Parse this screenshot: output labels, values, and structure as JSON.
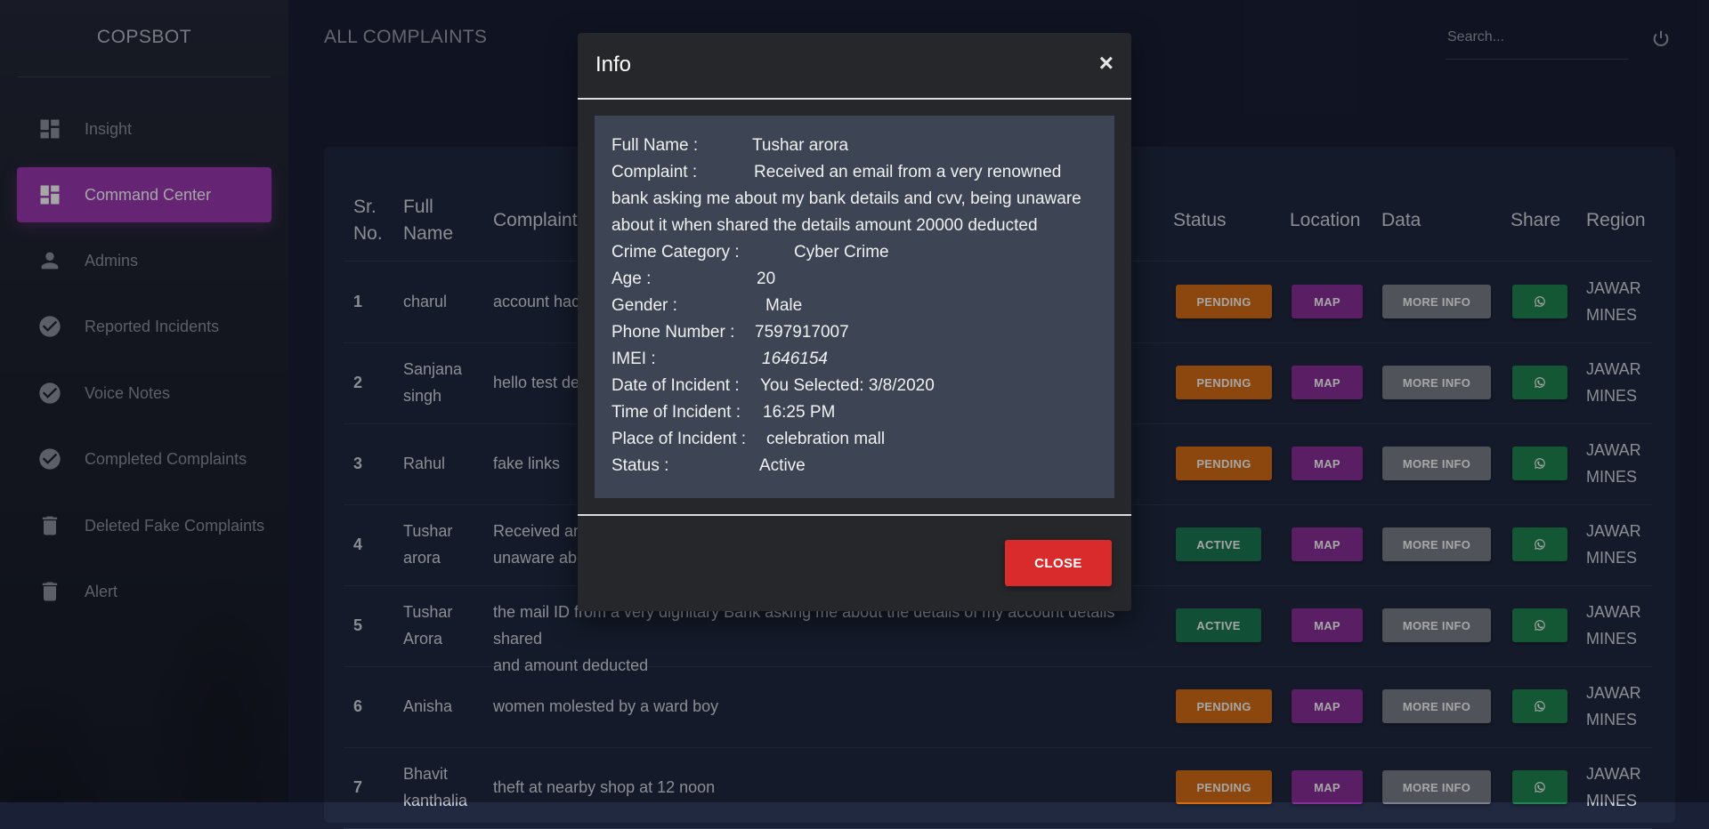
{
  "brand": "COPSBOT",
  "sidebar": {
    "items": [
      {
        "label": "Insight",
        "icon": "dashboard-icon",
        "active": false
      },
      {
        "label": "Command Center",
        "icon": "dashboard-icon",
        "active": true
      },
      {
        "label": "Admins",
        "icon": "person-icon",
        "active": false
      },
      {
        "label": "Reported Incidents",
        "icon": "check-circle-icon",
        "active": false
      },
      {
        "label": "Voice Notes",
        "icon": "check-circle-icon",
        "active": false
      },
      {
        "label": "Completed Complaints",
        "icon": "check-circle-icon",
        "active": false
      },
      {
        "label": "Deleted Fake Complaints",
        "icon": "trash-icon",
        "active": false
      },
      {
        "label": "Alert",
        "icon": "trash-icon",
        "active": false
      }
    ]
  },
  "header": {
    "title": "ALL COMPLAINTS",
    "search_placeholder": "Search..."
  },
  "table": {
    "columns": {
      "sr_line1": "Sr.",
      "sr_line2": "No.",
      "name_line1": "Full",
      "name_line2": "Name",
      "complaint": "Complaint",
      "status": "Status",
      "location": "Location",
      "data": "Data",
      "share": "Share",
      "region": "Region"
    },
    "buttons": {
      "map": "MAP",
      "more_info": "MORE INFO"
    },
    "rows": [
      {
        "num": "1",
        "name1": "charul",
        "name2": "",
        "c1": "account hac",
        "c2": "",
        "status": "PENDING",
        "region1": "JAWAR",
        "region2": "MINES"
      },
      {
        "num": "2",
        "name1": "Sanjana",
        "name2": "singh",
        "c1": "hello test de",
        "c2": "",
        "status": "PENDING",
        "region1": "JAWAR",
        "region2": "MINES"
      },
      {
        "num": "3",
        "name1": "Rahul",
        "name2": "",
        "c1": "fake links",
        "c2": "",
        "status": "PENDING",
        "region1": "JAWAR",
        "region2": "MINES"
      },
      {
        "num": "4",
        "name1": "Tushar",
        "name2": "arora",
        "c1": "Received an",
        "c2": "unaware abo",
        "status": "ACTIVE",
        "region1": "JAWAR",
        "region2": "MINES"
      },
      {
        "num": "5",
        "name1": "Tushar",
        "name2": "Arora",
        "c1": "the mail ID from a very dignitary Bank asking me about the details of my account details shared",
        "c2": "and amount deducted",
        "status": "ACTIVE",
        "region1": "JAWAR",
        "region2": "MINES"
      },
      {
        "num": "6",
        "name1": "Anisha",
        "name2": "",
        "c1": "women molested by a ward boy",
        "c2": "",
        "status": "PENDING",
        "region1": "JAWAR",
        "region2": "MINES"
      },
      {
        "num": "7",
        "name1": "Bhavit",
        "name2": "kanthalia",
        "c1": "theft at nearby shop at 12 noon",
        "c2": "",
        "status": "PENDING",
        "region1": "JAWAR",
        "region2": "MINES"
      }
    ]
  },
  "modal": {
    "title": "Info",
    "close_x": "×",
    "close_label": "CLOSE",
    "fields": {
      "full_name_label": "Full Name :",
      "full_name": "Tushar arora",
      "complaint_label": "Complaint :",
      "complaint_line1": "Received an email from a very renowned",
      "complaint_line2": "bank asking me about my bank details and cvv, being unaware",
      "complaint_line3": "about it when shared the details amount 20000 deducted",
      "crime_label": "Crime Category :",
      "crime": "Cyber Crime",
      "age_label": "Age :",
      "age": "20",
      "gender_label": "Gender :",
      "gender": "Male",
      "phone_label": "Phone Number :",
      "phone": "7597917007",
      "imei_label": "IMEI :",
      "imei": "1646154",
      "date_label": "Date of Incident :",
      "date": "You Selected: 3/8/2020",
      "time_label": "Time of Incident :",
      "time": "16:25 PM",
      "place_label": "Place of Incident :",
      "place": "celebration mall",
      "status_label": "Status :",
      "status": "Active"
    }
  },
  "colors": {
    "pending": "#d66d14",
    "active": "#1d7a55",
    "map": "#8a2f9c",
    "more_info": "#7d808a",
    "share": "#1f8652",
    "sidebar_active": "#9b38b3",
    "close": "#d92b2b"
  }
}
